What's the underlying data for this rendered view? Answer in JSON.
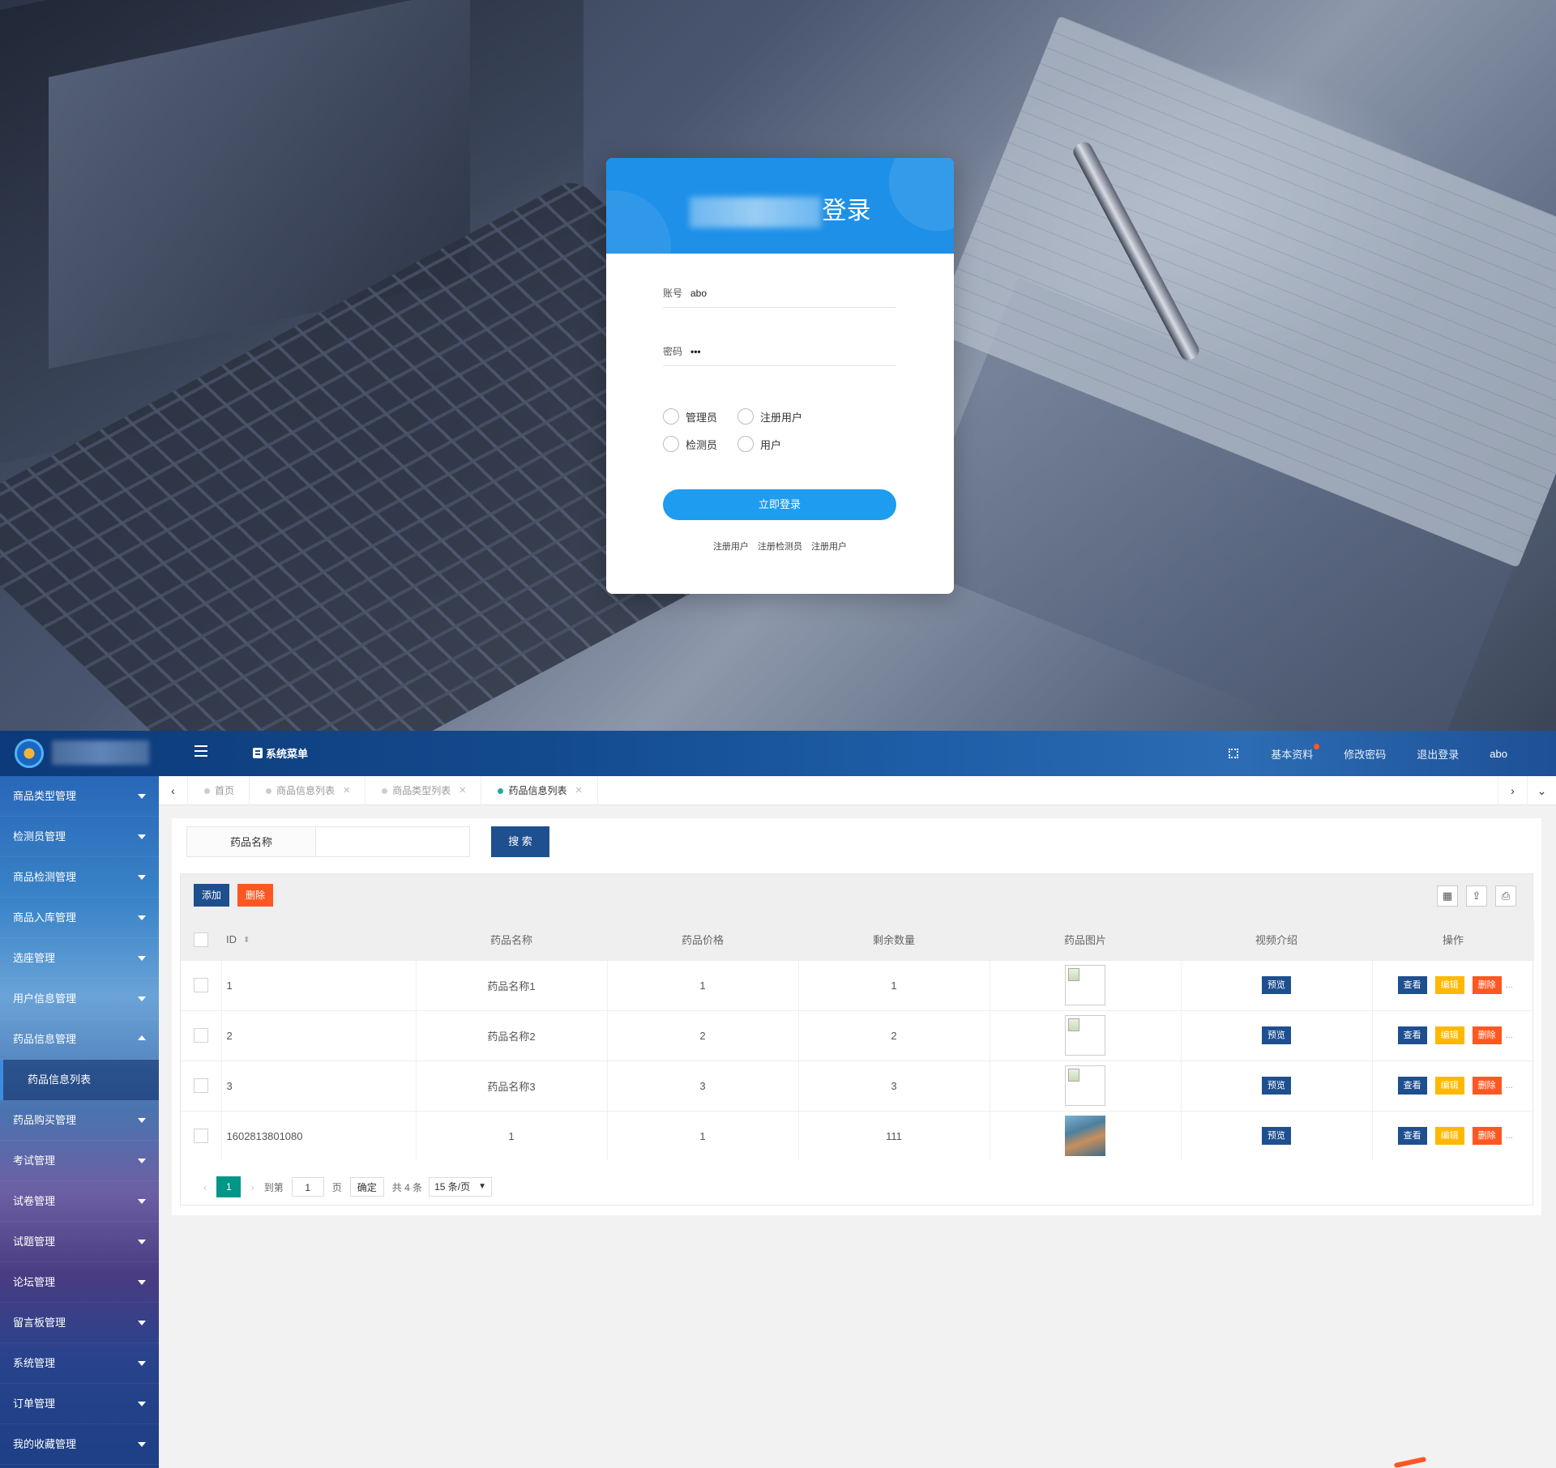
{
  "login": {
    "title_suffix": "登录",
    "account_label": "账号",
    "account_value": "abo",
    "password_label": "密码",
    "password_value": "•••",
    "roles": [
      "管理员",
      "注册用户",
      "检测员",
      "用户"
    ],
    "login_button": "立即登录",
    "register_links": [
      "注册用户",
      "注册检测员",
      "注册用户"
    ]
  },
  "header": {
    "system_menu": "系统菜单",
    "basic_info": "基本资料",
    "change_password": "修改密码",
    "logout": "退出登录",
    "username": "abo",
    "notification_color": "#ff5722"
  },
  "sidebar": {
    "items": [
      {
        "label": "商品类型管理",
        "open": false
      },
      {
        "label": "检测员管理",
        "open": false
      },
      {
        "label": "商品检测管理",
        "open": false
      },
      {
        "label": "商品入库管理",
        "open": false
      },
      {
        "label": "选座管理",
        "open": false
      },
      {
        "label": "用户信息管理",
        "open": false
      },
      {
        "label": "药品信息管理",
        "open": true
      },
      {
        "label": "药品购买管理",
        "open": false
      },
      {
        "label": "考试管理",
        "open": false
      },
      {
        "label": "试卷管理",
        "open": false
      },
      {
        "label": "试题管理",
        "open": false
      },
      {
        "label": "论坛管理",
        "open": false
      },
      {
        "label": "留言板管理",
        "open": false
      },
      {
        "label": "系统管理",
        "open": false
      },
      {
        "label": "订单管理",
        "open": false
      },
      {
        "label": "我的收藏管理",
        "open": false
      }
    ],
    "active_sub": "药品信息列表"
  },
  "tabs": [
    {
      "label": "首页",
      "closable": false,
      "active": false
    },
    {
      "label": "商品信息列表",
      "closable": true,
      "active": false
    },
    {
      "label": "商品类型列表",
      "closable": true,
      "active": false
    },
    {
      "label": "药品信息列表",
      "closable": true,
      "active": true
    }
  ],
  "search": {
    "label": "药品名称",
    "value": "",
    "button": "搜 索"
  },
  "toolbar": {
    "add": "添加",
    "delete": "删除",
    "icons": [
      "columns-icon",
      "export-icon",
      "print-icon"
    ]
  },
  "table": {
    "columns": [
      "ID",
      "药品名称",
      "药品价格",
      "剩余数量",
      "药品图片",
      "视频介绍",
      "操作"
    ],
    "rows": [
      {
        "id": "1",
        "name": "药品名称1",
        "price": "1",
        "stock": "1",
        "image": "broken",
        "video": "预览"
      },
      {
        "id": "2",
        "name": "药品名称2",
        "price": "2",
        "stock": "2",
        "image": "broken",
        "video": "预览"
      },
      {
        "id": "3",
        "name": "药品名称3",
        "price": "3",
        "stock": "3",
        "image": "broken",
        "video": "预览"
      },
      {
        "id": "1602813801080",
        "name": "1",
        "price": "1",
        "stock": "111",
        "image": "photo",
        "video": "预览"
      }
    ],
    "actions": {
      "view": "查看",
      "edit": "编辑",
      "delete": "删除",
      "more": "..."
    }
  },
  "pagination": {
    "current_page": "1",
    "goto_label": "到第",
    "goto_value": "1",
    "page_suffix": "页",
    "confirm": "确定",
    "total": "共 4 条",
    "page_size": "15 条/页"
  }
}
